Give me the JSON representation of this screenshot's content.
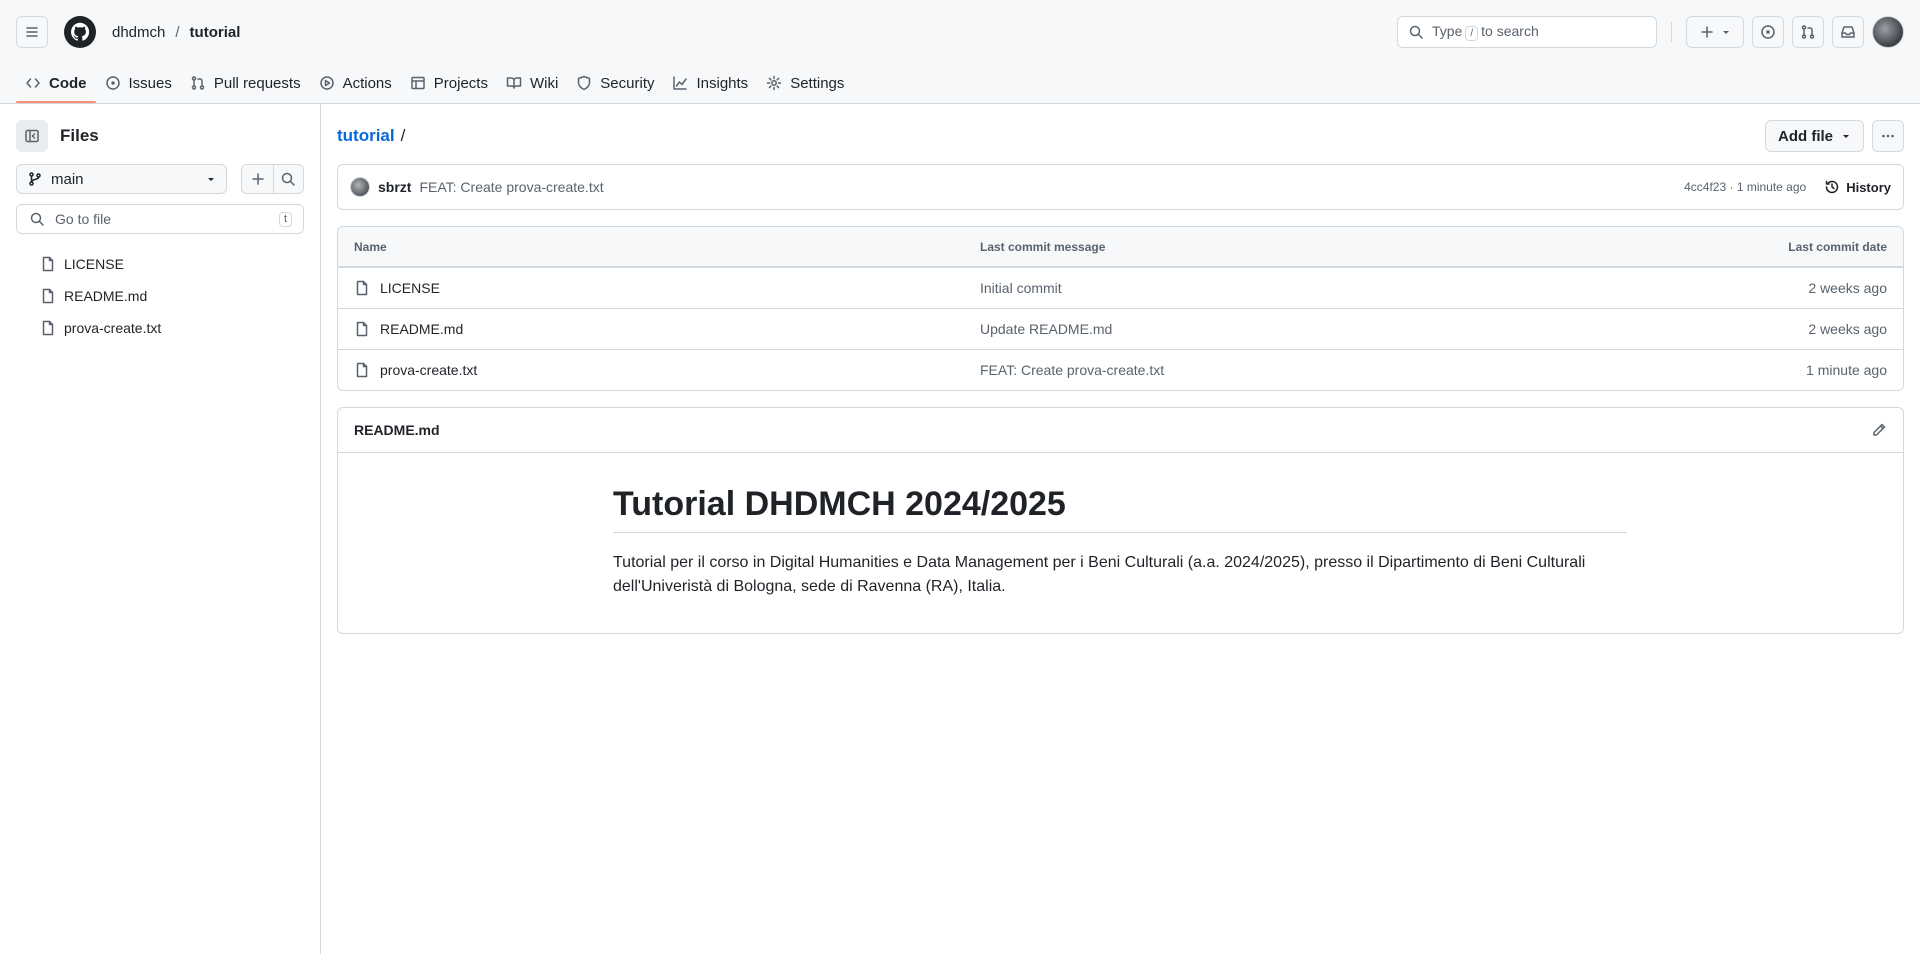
{
  "header": {
    "owner": "dhdmch",
    "separator": "/",
    "repo": "tutorial",
    "search_prefix": "Type",
    "search_key": "/",
    "search_suffix": "to search"
  },
  "tabs": [
    {
      "label": "Code",
      "icon": "code-icon",
      "active": true
    },
    {
      "label": "Issues",
      "icon": "issue-icon"
    },
    {
      "label": "Pull requests",
      "icon": "pull-request-icon"
    },
    {
      "label": "Actions",
      "icon": "play-icon"
    },
    {
      "label": "Projects",
      "icon": "table-icon"
    },
    {
      "label": "Wiki",
      "icon": "book-icon"
    },
    {
      "label": "Security",
      "icon": "shield-icon"
    },
    {
      "label": "Insights",
      "icon": "graph-icon"
    },
    {
      "label": "Settings",
      "icon": "gear-icon"
    }
  ],
  "sidebar": {
    "title": "Files",
    "branch": "main",
    "goto_placeholder": "Go to file",
    "goto_key": "t",
    "files": [
      "LICENSE",
      "README.md",
      "prova-create.txt"
    ]
  },
  "content": {
    "path_repo": "tutorial",
    "path_sep": "/",
    "add_file_label": "Add file",
    "commit": {
      "author": "sbrzt",
      "message": "FEAT: Create prova-create.txt",
      "meta": "4cc4f23 · 1 minute ago",
      "history_label": "History"
    },
    "table": {
      "headers": {
        "name": "Name",
        "message": "Last commit message",
        "date": "Last commit date"
      },
      "rows": [
        {
          "name": "LICENSE",
          "message": "Initial commit",
          "date": "2 weeks ago"
        },
        {
          "name": "README.md",
          "message": "Update README.md",
          "date": "2 weeks ago"
        },
        {
          "name": "prova-create.txt",
          "message": "FEAT: Create prova-create.txt",
          "date": "1 minute ago"
        }
      ]
    },
    "readme": {
      "filename": "README.md",
      "title": "Tutorial DHDMCH 2024/2025",
      "body": "Tutorial per il corso in Digital Humanities e Data Management per i Beni Culturali (a.a. 2024/2025), presso il Dipartimento di Beni Culturali dell'Univeristà di Bologna, sede di Ravenna (RA), Italia."
    }
  },
  "colors": {
    "accent": "#0969da",
    "tab_underline": "#fd8c73",
    "border": "#d1d9e0",
    "header_bg": "#f6f8fa"
  }
}
